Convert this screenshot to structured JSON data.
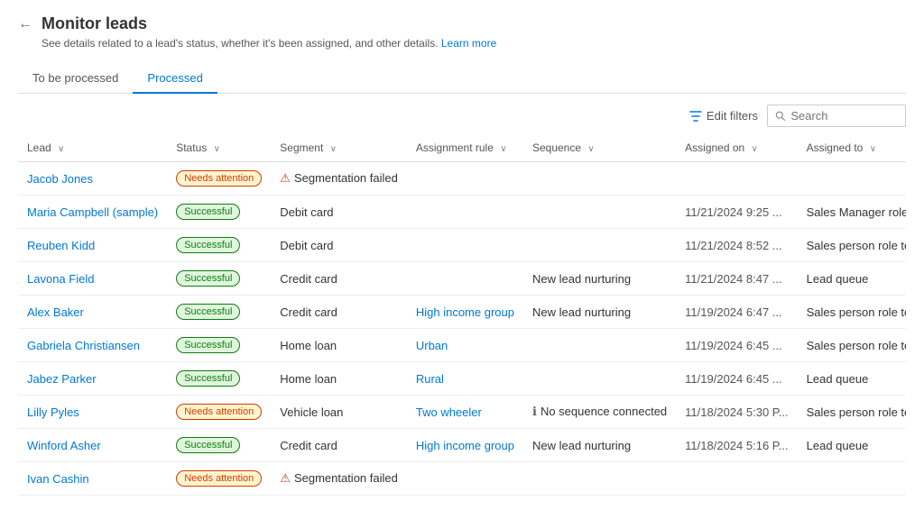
{
  "header": {
    "title": "Monitor leads",
    "subtitle": "See details related to a lead's status, whether it's been assigned, and other details.",
    "learn_more": "Learn more",
    "back_icon": "←"
  },
  "tabs": [
    {
      "label": "To be processed",
      "active": false
    },
    {
      "label": "Processed",
      "active": true
    }
  ],
  "toolbar": {
    "edit_filters_label": "Edit filters",
    "search_placeholder": "Search"
  },
  "table": {
    "columns": [
      {
        "label": "Lead",
        "sort": true
      },
      {
        "label": "Status",
        "sort": true
      },
      {
        "label": "Segment",
        "sort": true
      },
      {
        "label": "Assignment rule",
        "sort": true
      },
      {
        "label": "Sequence",
        "sort": true
      },
      {
        "label": "Assigned on",
        "sort": true
      },
      {
        "label": "Assigned to",
        "sort": true
      }
    ],
    "rows": [
      {
        "lead": "Jacob Jones",
        "status": "Needs attention",
        "status_type": "attention",
        "segment": "⚠ Segmentation failed",
        "segment_icon": true,
        "assignment_rule": "",
        "sequence": "",
        "assigned_on": "",
        "assigned_to": ""
      },
      {
        "lead": "Maria Campbell (sample)",
        "status": "Successful",
        "status_type": "success",
        "segment": "Debit card",
        "segment_icon": false,
        "assignment_rule": "",
        "sequence": "",
        "assigned_on": "11/21/2024 9:25 ...",
        "assigned_to": "Sales Manager role te..."
      },
      {
        "lead": "Reuben Kidd",
        "status": "Successful",
        "status_type": "success",
        "segment": "Debit card",
        "segment_icon": false,
        "assignment_rule": "",
        "sequence": "",
        "assigned_on": "11/21/2024 8:52 ...",
        "assigned_to": "Sales person role team"
      },
      {
        "lead": "Lavona Field",
        "status": "Successful",
        "status_type": "success",
        "segment": "Credit card",
        "segment_icon": false,
        "assignment_rule": "",
        "sequence": "New lead nurturing",
        "assigned_on": "11/21/2024 8:47 ...",
        "assigned_to": "Lead queue"
      },
      {
        "lead": "Alex Baker",
        "status": "Successful",
        "status_type": "success",
        "segment": "Credit card",
        "segment_icon": false,
        "assignment_rule": "High income group",
        "sequence": "New lead nurturing",
        "assigned_on": "11/19/2024 6:47 ...",
        "assigned_to": "Sales person role team"
      },
      {
        "lead": "Gabriela Christiansen",
        "status": "Successful",
        "status_type": "success",
        "segment": "Home loan",
        "segment_icon": false,
        "assignment_rule": "Urban",
        "sequence": "",
        "assigned_on": "11/19/2024 6:45 ...",
        "assigned_to": "Sales person role team"
      },
      {
        "lead": "Jabez Parker",
        "status": "Successful",
        "status_type": "success",
        "segment": "Home loan",
        "segment_icon": false,
        "assignment_rule": "Rural",
        "sequence": "",
        "assigned_on": "11/19/2024 6:45 ...",
        "assigned_to": "Lead queue"
      },
      {
        "lead": "Lilly Pyles",
        "status": "Needs attention",
        "status_type": "attention",
        "segment": "Vehicle loan",
        "segment_icon": false,
        "assignment_rule": "Two wheeler",
        "sequence": "ℹ No sequence connected",
        "sequence_icon": true,
        "assigned_on": "11/18/2024 5:30 P...",
        "assigned_to": "Sales person role team"
      },
      {
        "lead": "Winford Asher",
        "status": "Successful",
        "status_type": "success",
        "segment": "Credit card",
        "segment_icon": false,
        "assignment_rule": "High income group",
        "sequence": "New lead nurturing",
        "assigned_on": "11/18/2024 5:16 P...",
        "assigned_to": "Lead queue"
      },
      {
        "lead": "Ivan Cashin",
        "status": "Needs attention",
        "status_type": "attention",
        "segment": "⚠ Segmentation failed",
        "segment_icon": true,
        "assignment_rule": "",
        "sequence": "",
        "assigned_on": "",
        "assigned_to": ""
      }
    ]
  }
}
